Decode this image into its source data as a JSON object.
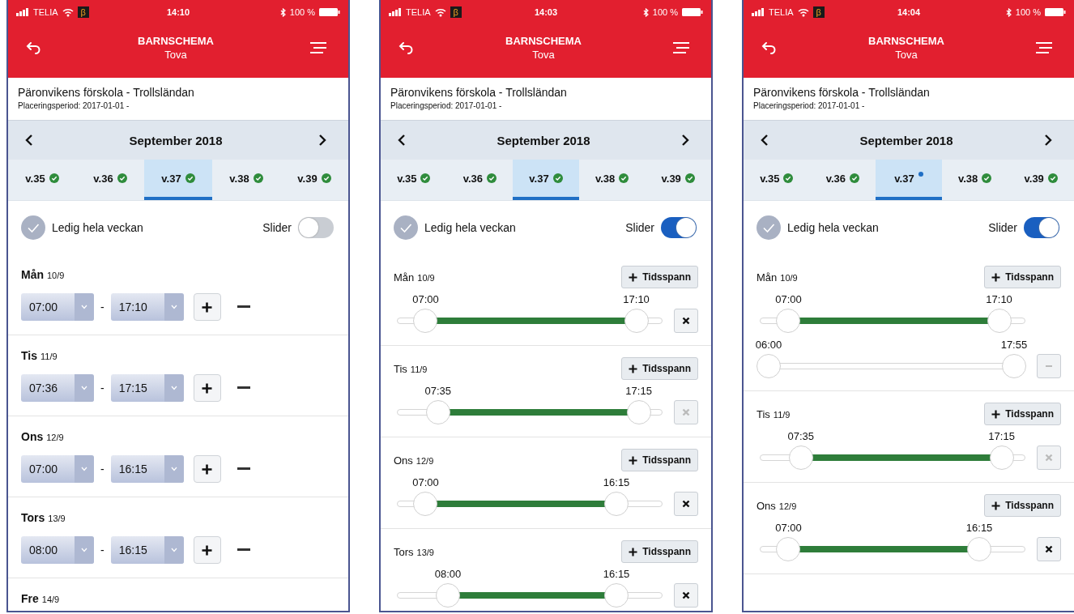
{
  "phones": [
    {
      "status": {
        "carrier": "TELIA",
        "beta": "β",
        "time": "14:10",
        "battery": "100 %"
      },
      "title": "BARNSCHEMA",
      "subtitle": "Tova",
      "school": "Päronvikens förskola - Trollsländan",
      "period": "Placeringsperiod: 2017-01-01 -",
      "month": "September 2018",
      "weeks": [
        {
          "label": "v.35",
          "selected": false,
          "kind": "check"
        },
        {
          "label": "v.36",
          "selected": false,
          "kind": "check"
        },
        {
          "label": "v.37",
          "selected": true,
          "kind": "check"
        },
        {
          "label": "v.38",
          "selected": false,
          "kind": "check"
        },
        {
          "label": "v.39",
          "selected": false,
          "kind": "check"
        }
      ],
      "free_week": {
        "label": "Ledig hela veckan",
        "checked": false
      },
      "slider_toggle": {
        "label": "Slider",
        "on": false
      },
      "days": [
        {
          "kind": "select",
          "day": "Mån",
          "date": "10/9",
          "start": "07:00",
          "separator": "-",
          "end": "17:10"
        },
        {
          "kind": "select",
          "day": "Tis",
          "date": "11/9",
          "start": "07:36",
          "separator": "-",
          "end": "17:15"
        },
        {
          "kind": "select",
          "day": "Ons",
          "date": "12/9",
          "start": "07:00",
          "separator": "-",
          "end": "16:15"
        },
        {
          "kind": "select",
          "day": "Tors",
          "date": "13/9",
          "start": "08:00",
          "separator": "-",
          "end": "16:15"
        },
        {
          "kind": "select",
          "day": "Fre",
          "date": "14/9"
        }
      ]
    },
    {
      "status": {
        "carrier": "TELIA",
        "beta": "β",
        "time": "14:03",
        "battery": "100 %"
      },
      "title": "BARNSCHEMA",
      "subtitle": "Tova",
      "school": "Päronvikens förskola - Trollsländan",
      "period": "Placeringsperiod: 2017-01-01 -",
      "month": "September 2018",
      "weeks": [
        {
          "label": "v.35",
          "selected": false,
          "kind": "check"
        },
        {
          "label": "v.36",
          "selected": false,
          "kind": "check"
        },
        {
          "label": "v.37",
          "selected": true,
          "kind": "check"
        },
        {
          "label": "v.38",
          "selected": false,
          "kind": "check"
        },
        {
          "label": "v.39",
          "selected": false,
          "kind": "check"
        }
      ],
      "free_week": {
        "label": "Ledig hela veckan",
        "checked": false
      },
      "slider_toggle": {
        "label": "Slider",
        "on": true
      },
      "days": [
        {
          "kind": "slider",
          "day": "Mån",
          "date": "10/9",
          "add_label": "Tidsspann",
          "ranges": [
            {
              "start": "07:00",
              "end": "17:10",
              "filled": true,
              "handles": [
                {
                  "level": 0.08
                },
                {
                  "level": 0.93
                }
              ],
              "remove": {
                "kind": "close",
                "disabled": false
              }
            }
          ]
        },
        {
          "kind": "slider",
          "day": "Tis",
          "date": "11/9",
          "add_label": "Tidsspann",
          "ranges": [
            {
              "start": "07:35",
              "end": "17:15",
              "filled": true,
              "handles": [
                {
                  "level": 0.13
                },
                {
                  "level": 0.94
                }
              ],
              "remove": {
                "kind": "close",
                "disabled": true
              }
            }
          ]
        },
        {
          "kind": "slider",
          "day": "Ons",
          "date": "12/9",
          "add_label": "Tidsspann",
          "ranges": [
            {
              "start": "07:00",
              "end": "16:15",
              "filled": true,
              "handles": [
                {
                  "level": 0.08
                },
                {
                  "level": 0.85
                }
              ],
              "remove": {
                "kind": "close",
                "disabled": false
              }
            }
          ]
        },
        {
          "kind": "slider",
          "day": "Tors",
          "date": "13/9",
          "add_label": "Tidsspann",
          "ranges": [
            {
              "start": "08:00",
              "end": "16:15",
              "filled": true,
              "handles": [
                {
                  "level": 0.17
                },
                {
                  "level": 0.85
                }
              ],
              "remove": {
                "kind": "close",
                "disabled": false
              }
            }
          ]
        }
      ]
    },
    {
      "status": {
        "carrier": "TELIA",
        "beta": "β",
        "time": "14:04",
        "battery": "100 %"
      },
      "title": "BARNSCHEMA",
      "subtitle": "Tova",
      "school": "Päronvikens förskola - Trollsländan",
      "period": "Placeringsperiod: 2017-01-01 -",
      "month": "September 2018",
      "weeks": [
        {
          "label": "v.35",
          "selected": false,
          "kind": "check"
        },
        {
          "label": "v.36",
          "selected": false,
          "kind": "check"
        },
        {
          "label": "v.37",
          "selected": true,
          "kind": "dot"
        },
        {
          "label": "v.38",
          "selected": false,
          "kind": "check"
        },
        {
          "label": "v.39",
          "selected": false,
          "kind": "check"
        }
      ],
      "free_week": {
        "label": "Ledig hela veckan",
        "checked": false
      },
      "slider_toggle": {
        "label": "Slider",
        "on": true
      },
      "days": [
        {
          "kind": "slider",
          "day": "Mån",
          "date": "10/9",
          "add_label": "Tidsspann",
          "ranges": [
            {
              "start": "07:00",
              "end": "17:10",
              "filled": true,
              "handles": [
                {
                  "level": 0.08
                },
                {
                  "level": 0.93
                }
              ]
            },
            {
              "start": "06:00",
              "end": "17:55",
              "filled": false,
              "handles": [
                {
                  "level": 0.0
                },
                {
                  "level": 0.99
                }
              ],
              "remove": {
                "kind": "minus",
                "disabled": true
              }
            }
          ]
        },
        {
          "kind": "slider",
          "day": "Tis",
          "date": "11/9",
          "add_label": "Tidsspann",
          "ranges": [
            {
              "start": "07:35",
              "end": "17:15",
              "filled": true,
              "handles": [
                {
                  "level": 0.13
                },
                {
                  "level": 0.94
                }
              ],
              "remove": {
                "kind": "close",
                "disabled": true
              }
            }
          ]
        },
        {
          "kind": "slider",
          "day": "Ons",
          "date": "12/9",
          "add_label": "Tidsspann",
          "ranges": [
            {
              "start": "07:00",
              "end": "16:15",
              "filled": true,
              "handles": [
                {
                  "level": 0.08
                },
                {
                  "level": 0.85
                }
              ],
              "remove": {
                "kind": "close",
                "disabled": false
              }
            }
          ]
        }
      ]
    }
  ]
}
